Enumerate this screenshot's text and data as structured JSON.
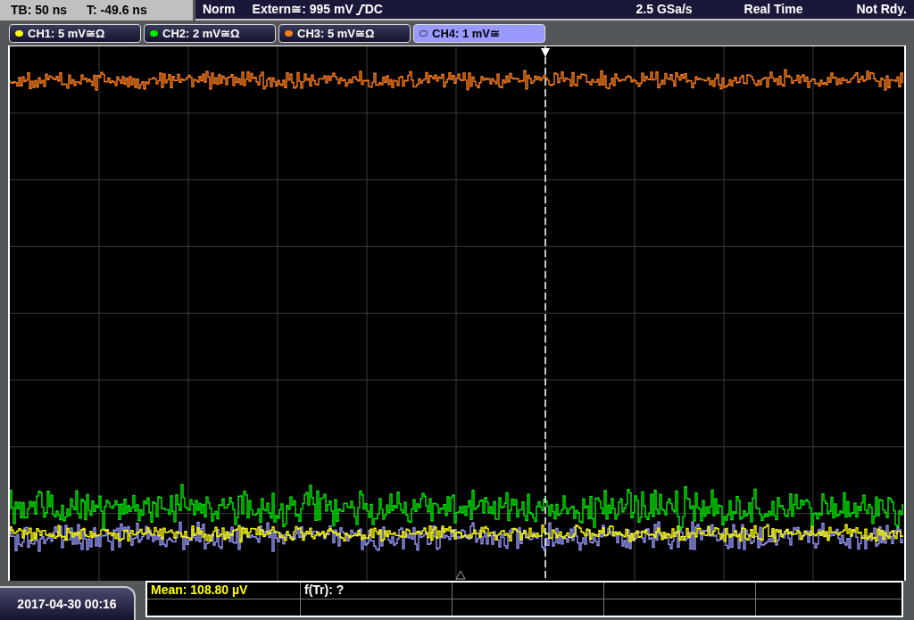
{
  "header": {
    "timebase": "TB: 50 ns",
    "trigger_time": "T: -49.6 ns"
  },
  "trigger": {
    "mode": "Norm",
    "source": "Extern≅: 995 mV",
    "coupling": "DC"
  },
  "sample_rate": "2.5 GSa/s",
  "acquisition": "Real Time",
  "status": "Not Rdy.",
  "channels": [
    {
      "label": "CH1: 5 mV≅Ω",
      "color": "#ffff00",
      "selected": false
    },
    {
      "label": "CH2: 2 mV≅Ω",
      "color": "#00ee00",
      "selected": false
    },
    {
      "label": "CH3: 5 mV≅Ω",
      "color": "#ff7f1e",
      "selected": false
    },
    {
      "label": "CH4: 1 mV≅",
      "color": "#9999ff",
      "selected": true
    }
  ],
  "measurements": [
    {
      "text": "Mean: 108.80 µV",
      "color": "#ffff00"
    },
    {
      "text": "f(Tr): ?",
      "color": "#ffffff"
    }
  ],
  "date": "2017-04-30 00:16"
}
